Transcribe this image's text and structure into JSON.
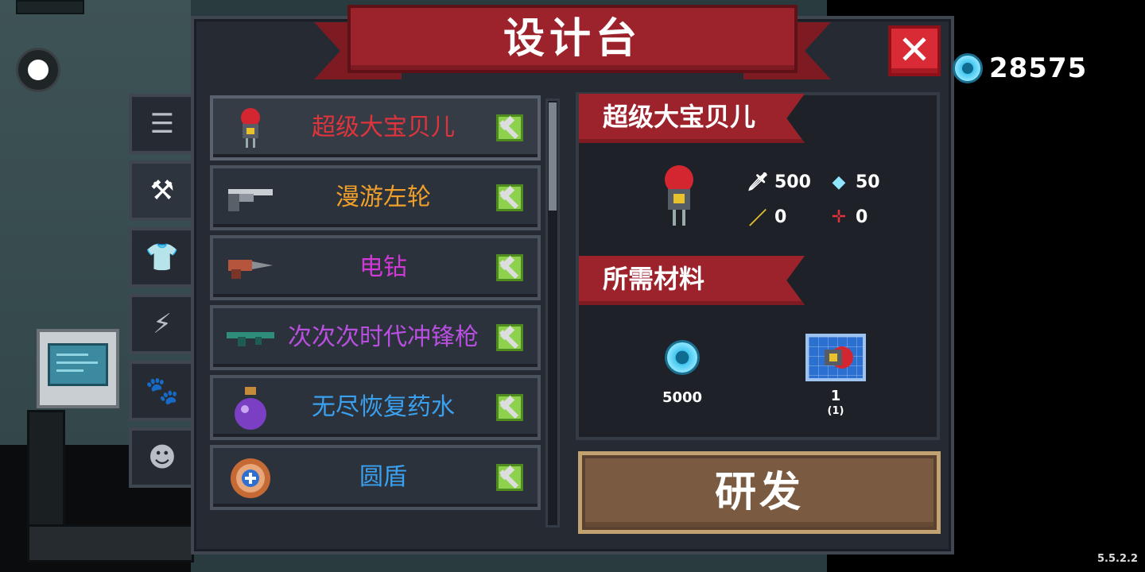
{
  "title": "设计台",
  "currency": {
    "icon": "gem-icon",
    "amount": "28575"
  },
  "side_tabs": [
    {
      "icon": "list-icon",
      "glyph": "☰"
    },
    {
      "icon": "weapon-icon",
      "glyph": "⚒"
    },
    {
      "icon": "armor-icon",
      "glyph": "👕"
    },
    {
      "icon": "skill-icon",
      "glyph": "⚡"
    },
    {
      "icon": "pet-icon",
      "glyph": "🐾"
    },
    {
      "icon": "character-icon",
      "glyph": "☻"
    }
  ],
  "items": [
    {
      "name": "超级大宝贝儿",
      "color": "#e0343c",
      "icon": "robot-bomb-icon"
    },
    {
      "name": "漫游左轮",
      "color": "#f0a02a",
      "icon": "revolver-icon"
    },
    {
      "name": "电钻",
      "color": "#cf3ad6",
      "icon": "drill-icon"
    },
    {
      "name": "次次次时代冲锋枪",
      "color": "#b84fe0",
      "icon": "smg-icon"
    },
    {
      "name": "无尽恢复药水",
      "color": "#3aa0f0",
      "icon": "potion-icon"
    },
    {
      "name": "圆盾",
      "color": "#3aa0f0",
      "icon": "shield-icon"
    }
  ],
  "detail": {
    "name": "超级大宝贝儿",
    "stats": {
      "attack": "500",
      "energy": "50",
      "crit": "0",
      "accuracy": "0"
    },
    "materials_title": "所需材料",
    "materials": [
      {
        "icon": "gem-icon",
        "label": "5000"
      },
      {
        "icon": "blueprint-icon",
        "label": "1",
        "sub": "(1)"
      }
    ]
  },
  "research_label": "研发",
  "version": "5.5.2.2",
  "colors": {
    "banner": "#9c222b",
    "panel": "#262b33",
    "research": "#7a5a40"
  }
}
